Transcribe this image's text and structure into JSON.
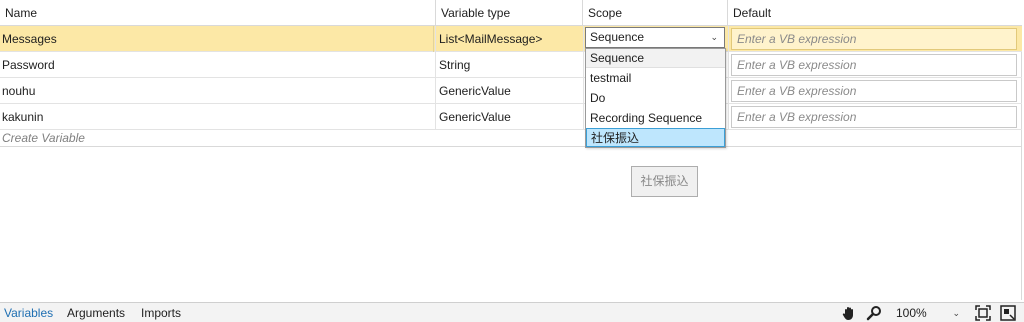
{
  "columns": {
    "name": "Name",
    "type": "Variable type",
    "scope": "Scope",
    "default": "Default"
  },
  "rows": [
    {
      "name": "Messages",
      "type": "List<MailMessage>",
      "scope": "Sequence",
      "default_placeholder": "Enter a VB expression",
      "selected": true
    },
    {
      "name": "Password",
      "type": "String",
      "default_placeholder": "Enter a VB expression"
    },
    {
      "name": "nouhu",
      "type": "GenericValue",
      "default_placeholder": "Enter a VB expression"
    },
    {
      "name": "kakunin",
      "type": "GenericValue",
      "default_placeholder": "Enter a VB expression"
    }
  ],
  "create_variable": "Create Variable",
  "scope_dropdown": {
    "selected": "Sequence",
    "options": [
      "Sequence",
      "testmail",
      "Do",
      "Recording Sequence",
      "社保振込"
    ],
    "highlighted_index": 4
  },
  "ghost_button": "社保振込",
  "bottom_tabs": [
    "Variables",
    "Arguments",
    "Imports"
  ],
  "active_tab": "Variables",
  "zoom": "100%",
  "icons": [
    "hand-pan-icon",
    "magnifier-icon",
    "fit-screen-icon",
    "overview-icon"
  ],
  "colors": {
    "selected_row": "#fce8a6",
    "highlight_option": "#bee6fd",
    "active_tab": "#1f6fb2"
  }
}
